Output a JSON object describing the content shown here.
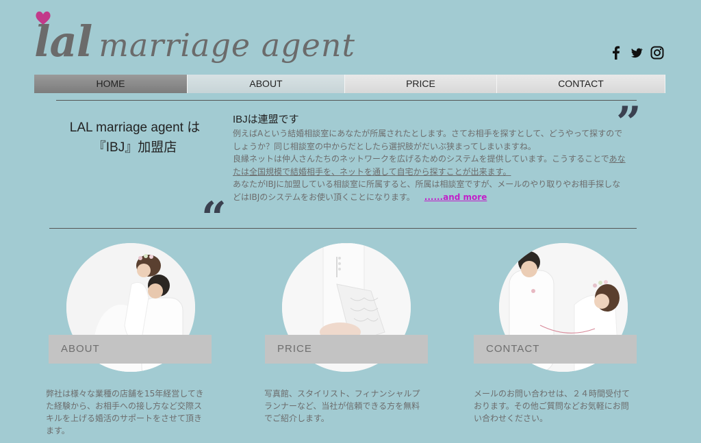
{
  "logo": {
    "part1": "lal",
    "part2": "marriage agent"
  },
  "social": [
    "facebook-icon",
    "twitter-icon",
    "instagram-icon"
  ],
  "nav": {
    "items": [
      "HOME",
      "ABOUT",
      "PRICE",
      "CONTACT"
    ],
    "active": "HOME"
  },
  "intro": {
    "heading_line1": "LAL marriage agent は",
    "heading_line2": "『IBJ』加盟店",
    "title": "IBJは連盟です",
    "para1": "例えばAという結婚相談室にあなたが所属されたとします。さてお相手を探すとして、どうやって探すのでしょうか？同じ相談室の中からだとしたら選択肢がだいぶ狭まってしまいますね。",
    "para2_start": "良縁ネットは仲人さんたちのネットワークを広げるためのシステムを提供しています。こうすることで",
    "para2_underlined": "あなたは全国規模で結婚相手を、ネットを通して自宅から探すことが出来ます。",
    "para3": "あなたがIBJに加盟している相談室に所属すると、所属は相談室ですが、メールのやり取りやお相手探しなどはIBJのシステムをお使い頂くことになります。",
    "more_link": "......and more",
    "quote_close": "”",
    "quote_open": "“"
  },
  "cards": [
    {
      "label": "ABOUT",
      "text": "弊社は様々な業種の店舗を15年経営してきた経験から、お相手への接し方など交際スキルを上げる婚活のサポートをさせて頂きます。"
    },
    {
      "label": "PRICE",
      "text": "写真館、スタイリスト、フィナンシャルプランナーなど、当社が信頼できる方を無料でご紹介します。"
    },
    {
      "label": "CONTACT",
      "text": "メールのお問い合わせは、２４時間受付ております。その他ご質問などお気軽にお問い合わせください。"
    }
  ],
  "colors": {
    "background": "#a2cbd2",
    "accent_link": "#c21ec9",
    "heart": "#c23a8a"
  }
}
